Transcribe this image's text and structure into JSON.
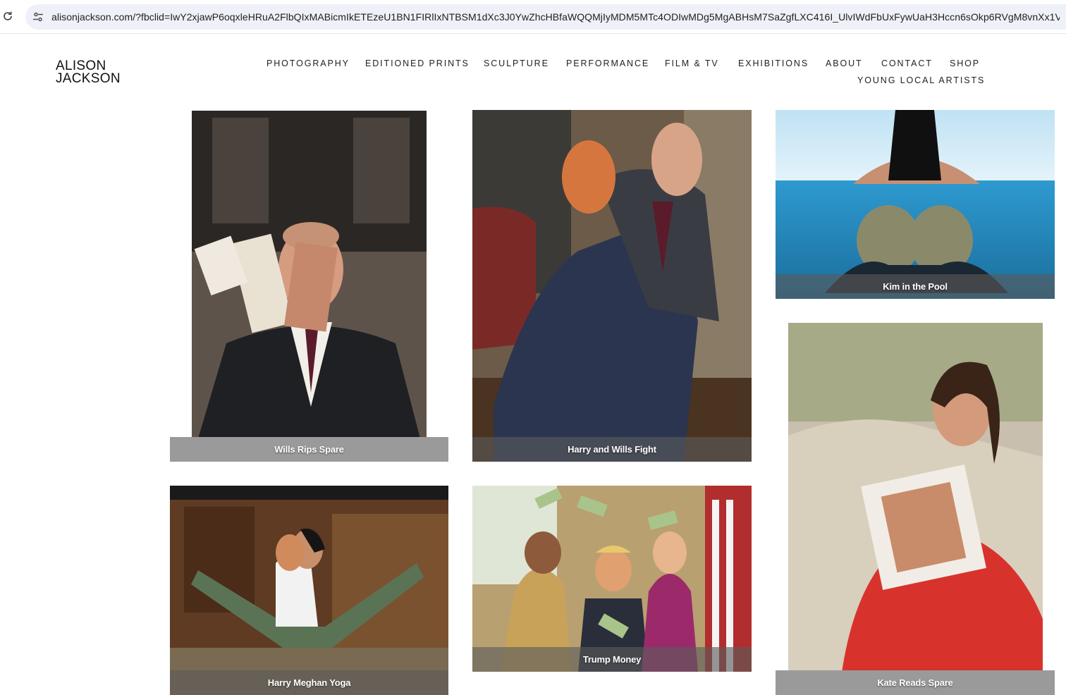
{
  "browser": {
    "url": "alisonjackson.com/?fbclid=IwY2xjawP6oqxleHRuA2FlbQIxMABicmIkETEzeU1BN1FIRlIxNTBSM1dXc3J0YwZhcHBfaWQQMjIyMDM5MTc4ODIwMDg5MgABHsM7SaZgfLXC416I_UlvIWdFbUxFywUaH3Hccn6sOkp6RVgM8vnXx1VTxXho_ae..."
  },
  "site": {
    "logo_line1": "ALISON",
    "logo_line2": "JACKSON"
  },
  "nav": {
    "photography": "PHOTOGRAPHY",
    "editioned_prints": "EDITIONED PRINTS",
    "sculpture": "SCULPTURE",
    "performance": "PERFORMANCE",
    "film_tv": "FILM & TV",
    "exhibitions": "EXHIBITIONS",
    "about": "ABOUT",
    "contact": "CONTACT",
    "shop": "SHOP",
    "young_local_artists": "YOUNG LOCAL ARTISTS"
  },
  "gallery": {
    "wills_rips_spare": "Wills Rips Spare",
    "harry_wills_fight": "Harry and Wills Fight",
    "kim_pool": "Kim in the Pool",
    "harry_meghan_yoga": "Harry Meghan Yoga",
    "trump_money": "Trump Money",
    "kate_reads_spare": "Kate Reads Spare"
  },
  "colors": {
    "url_bar_bg": "#eef1f8",
    "caption_band": "#9a9a9a",
    "nav_text": "#222222"
  },
  "icons": {
    "reload": "reload-icon",
    "site_settings": "tune-icon"
  }
}
